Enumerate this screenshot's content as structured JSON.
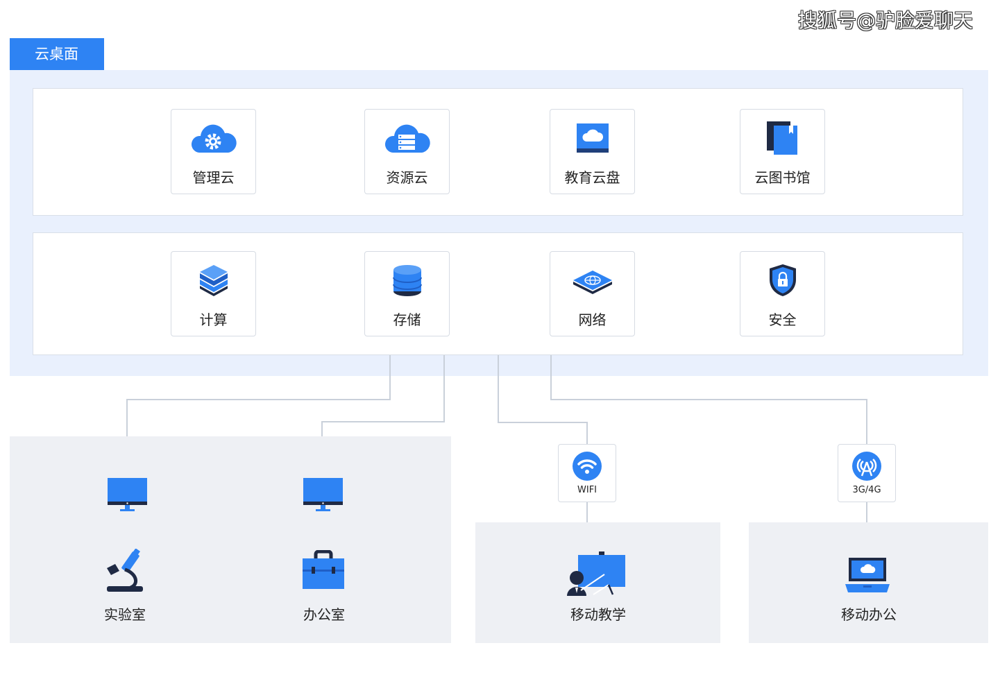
{
  "watermark": "搜狐号@驴脸爱聊天",
  "cloud_tab": "云桌面",
  "platform_services": [
    {
      "label": "管理云",
      "icon": "gear-cloud-icon"
    },
    {
      "label": "资源云",
      "icon": "server-cloud-icon"
    },
    {
      "label": "教育云盘",
      "icon": "cloud-disk-icon"
    },
    {
      "label": "云图书馆",
      "icon": "library-books-icon"
    }
  ],
  "infrastructure": [
    {
      "label": "计算",
      "icon": "layers-icon"
    },
    {
      "label": "存储",
      "icon": "database-icon"
    },
    {
      "label": "网络",
      "icon": "network-switch-icon"
    },
    {
      "label": "安全",
      "icon": "shield-lock-icon"
    }
  ],
  "connections": [
    {
      "label": "WIFI",
      "icon": "wifi-icon"
    },
    {
      "label": "3G/4G",
      "icon": "cellular-antenna-icon"
    }
  ],
  "scenarios": [
    {
      "label": "实验室",
      "icon": "microscope-icon"
    },
    {
      "label": "办公室",
      "icon": "briefcase-icon"
    },
    {
      "label": "移动教学",
      "icon": "teaching-board-icon"
    },
    {
      "label": "移动办公",
      "icon": "laptop-cloud-icon"
    }
  ],
  "colors": {
    "accent": "#2e83f3",
    "dark_blue": "#1f5fc6",
    "panel": "#e9f0fd",
    "zone": "#eef0f4",
    "line": "#c9d0da"
  }
}
